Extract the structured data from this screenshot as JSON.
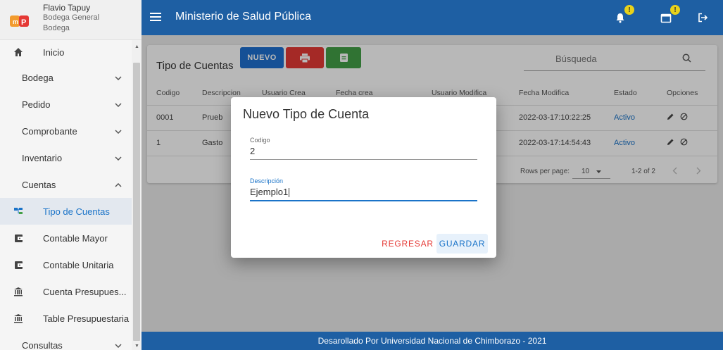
{
  "user": {
    "name": "Flavio Tapuy",
    "role": "Bodega General",
    "dept": "Bodega"
  },
  "sidebar": {
    "items": [
      {
        "label": "Inicio",
        "icon": "home-icon"
      },
      {
        "label": "Bodega",
        "chevron": "⌄"
      },
      {
        "label": "Pedido",
        "chevron": "⌄"
      },
      {
        "label": "Comprobante",
        "chevron": "⌄"
      },
      {
        "label": "Inventario",
        "chevron": "⌄"
      },
      {
        "label": "Cuentas",
        "chevron": "⌃"
      },
      {
        "label": "Tipo de Cuentas",
        "icon": "account-tree-icon"
      },
      {
        "label": "Contable Mayor",
        "icon": "wallet-icon"
      },
      {
        "label": "Contable Unitaria",
        "icon": "wallet-icon"
      },
      {
        "label": "Cuenta Presupues...",
        "icon": "bank-icon"
      },
      {
        "label": "Table Presupuestaria",
        "icon": "bank-icon"
      },
      {
        "label": "Consultas",
        "chevron": "⌄"
      }
    ]
  },
  "topbar": {
    "title": "Ministerio de Salud Pública",
    "badge": "!"
  },
  "card": {
    "title": "Tipo de Cuentas",
    "new_label": "NUEVO",
    "search_placeholder": "Búsqueda"
  },
  "table": {
    "headers": [
      "Codigo",
      "Descripcion",
      "Usuario Crea",
      "Fecha crea",
      "Usuario Modifica",
      "Fecha Modifica",
      "Estado",
      "Opciones"
    ],
    "rows": [
      {
        "codigo": "0001",
        "descripcion": "Prueb",
        "fecha_mod": "2022-03-17:10:22:25",
        "estado": "Activo"
      },
      {
        "codigo": "1",
        "descripcion": "Gasto",
        "fecha_mod": "2022-03-17:14:54:43",
        "estado": "Activo"
      }
    ],
    "rows_per_page_label": "Rows per page:",
    "rows_per_page": "10",
    "range": "1-2 of 2"
  },
  "dialog": {
    "title": "Nuevo Tipo de Cuenta",
    "codigo_label": "Codigo",
    "codigo_value": "2",
    "descripcion_label": "Descripción",
    "descripcion_value": "Ejemplo1",
    "back_label": "REGRESAR",
    "save_label": "GUARDAR"
  },
  "footer": "Desarollado Por Universidad Nacional de Chimborazo - 2021",
  "colors": {
    "primary": "#1e5fa3",
    "accent_blue": "#1a73c8",
    "red": "#e53935",
    "green": "#43a047",
    "badge": "#e8d21a"
  }
}
